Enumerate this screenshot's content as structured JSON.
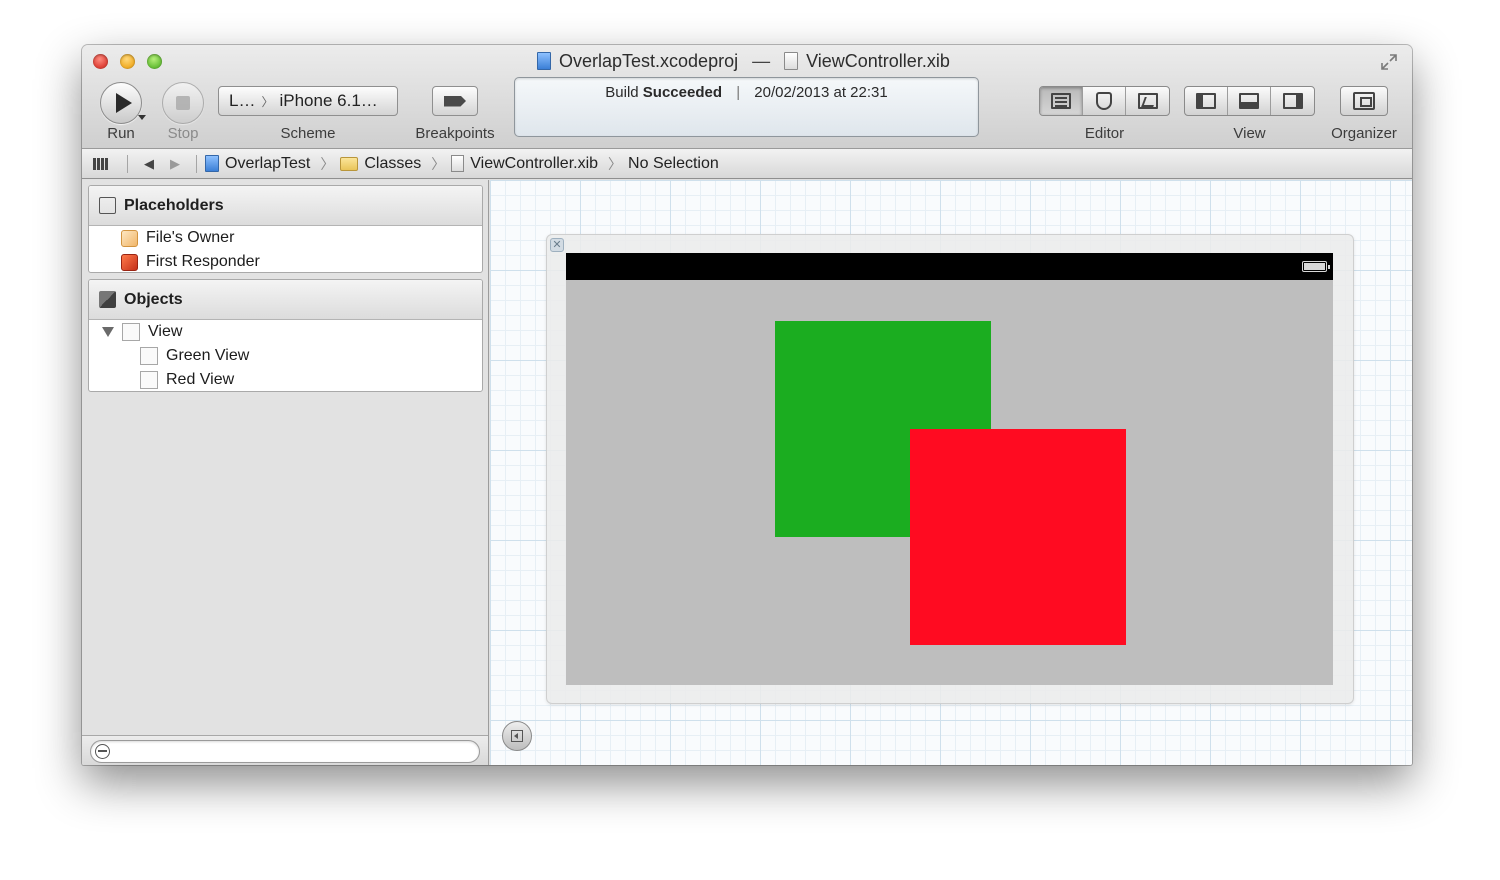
{
  "window": {
    "project_file": "OverlapTest.xcodeproj",
    "title_separator": "—",
    "document_file": "ViewController.xib"
  },
  "toolbar": {
    "run_label": "Run",
    "stop_label": "Stop",
    "scheme_target": "L…",
    "scheme_sep": "〉",
    "scheme_device": "iPhone 6.1…",
    "scheme_label": "Scheme",
    "breakpoints_label": "Breakpoints",
    "editor_label": "Editor",
    "view_label": "View",
    "organizer_label": "Organizer"
  },
  "activity": {
    "status_prefix": "Build",
    "status_result": "Succeeded",
    "divider": "|",
    "timestamp": "20/02/2013 at 22:31"
  },
  "jumpbar": {
    "back_arrow": "◀",
    "forward_arrow": "▶",
    "crumbs": [
      "OverlapTest",
      "Classes",
      "ViewController.xib",
      "No Selection"
    ],
    "sep": "〉"
  },
  "outline": {
    "placeholders": {
      "title": "Placeholders",
      "items": [
        "File's Owner",
        "First Responder"
      ]
    },
    "objects": {
      "title": "Objects",
      "root": "View",
      "children": [
        "Green View",
        "Red View"
      ]
    }
  },
  "canvas": {
    "close_glyph": "✕",
    "green_color": "#1bad20",
    "red_color": "#ff0b21",
    "device_background": "#bebebe"
  },
  "icons": {
    "run": "play-icon",
    "stop": "stop-icon",
    "breakpoints": "breakpoint-arrow-icon",
    "editor_standard": "standard-editor-icon",
    "editor_assistant": "assistant-editor-icon",
    "editor_version": "version-editor-icon",
    "view_navigator": "navigator-panel-icon",
    "view_debug": "debug-area-icon",
    "view_utilities": "utilities-panel-icon",
    "organizer": "organizer-icon"
  }
}
